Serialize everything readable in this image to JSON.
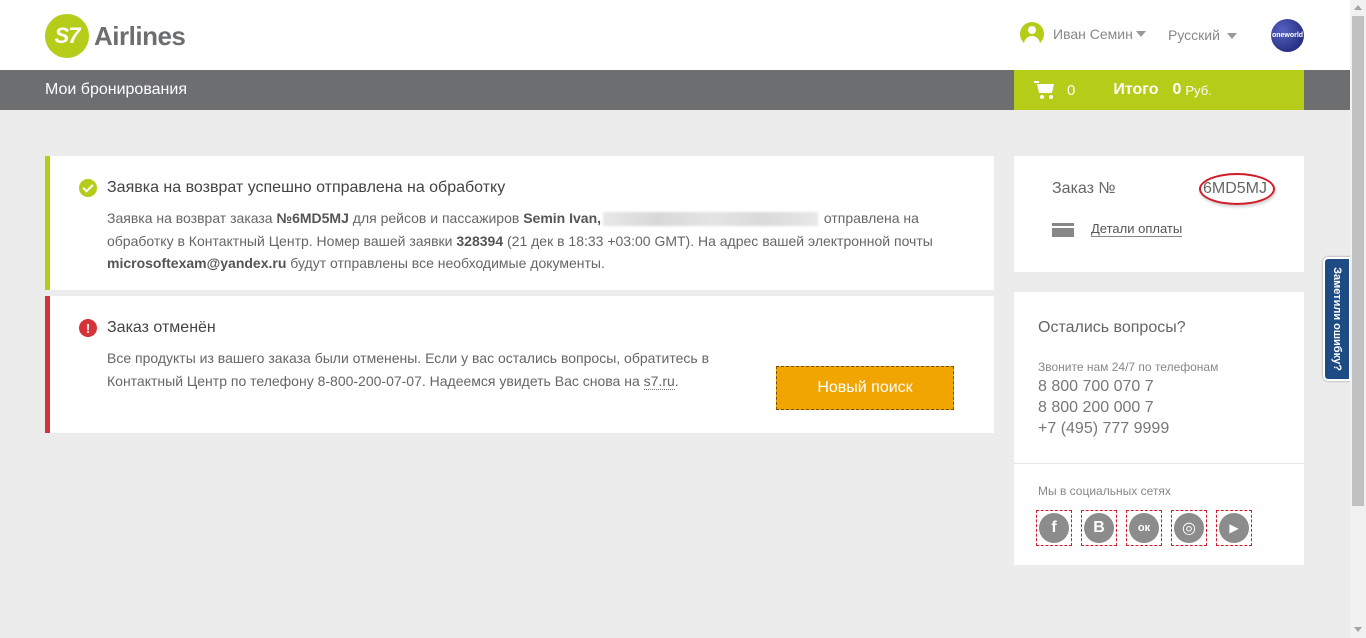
{
  "header": {
    "logo_mark": "S7",
    "logo_text": "Airlines",
    "user_name": "Иван Семин",
    "language": "Русский",
    "alliance_logo": "oneworld"
  },
  "navbar": {
    "title": "Мои бронирования",
    "cart_count": "0",
    "total_label": "Итого",
    "total_value": "0",
    "currency": "Руб."
  },
  "success_card": {
    "title": "Заявка на возврат успешно отправлена на обработку",
    "t1": "Заявка на возврат заказа ",
    "order_ref": "№6MD5MJ",
    "t2": " для рейсов и пассажиров ",
    "passenger": "Semin Ivan,",
    "t3": " отправлена на обработку в Контактный Центр. Номер вашей заявки ",
    "request_number": "328394",
    "t4": " (21 дек в 18:33 +03:00 GMT). На адрес вашей электронной почты ",
    "email": "microsoftexam@yandex.ru",
    "t5": " будут отправлены все необходимые документы."
  },
  "error_card": {
    "title": "Заказ отменён",
    "t1": "Все продукты из вашего заказа были отменены. Если у вас остались вопросы, обратитесь в Контактный Центр по телефону 8-800-200-07-07. Надеемся увидеть Вас снова на ",
    "link": "s7.ru",
    "t2": ".",
    "button": "Новый поиск"
  },
  "order_card": {
    "label": "Заказ №",
    "number": "6MD5MJ",
    "payment_link": "Детали оплаты"
  },
  "help_card": {
    "title": "Остались вопросы?",
    "subtitle": "Звоните нам 24/7 по телефонам",
    "phones": [
      "8 800 700 070 7",
      "8 800 200 000 7",
      "+7 (495) 777 9999"
    ],
    "social_label": "Мы в социальных сетях",
    "social": [
      {
        "name": "facebook-icon",
        "glyph": "f"
      },
      {
        "name": "vkontakte-icon",
        "glyph": "B"
      },
      {
        "name": "odnoklassniki-icon",
        "glyph": "ок"
      },
      {
        "name": "instagram-icon",
        "glyph": "◎"
      },
      {
        "name": "youtube-icon",
        "glyph": "▶"
      }
    ]
  },
  "feedback_tab": "Заметили ошибку?",
  "colors": {
    "brand_green": "#b5cc18",
    "nav_gray": "#6d6e70",
    "error_red": "#d6323a",
    "button_orange": "#f0a500",
    "feedback_blue": "#1f4b85"
  }
}
